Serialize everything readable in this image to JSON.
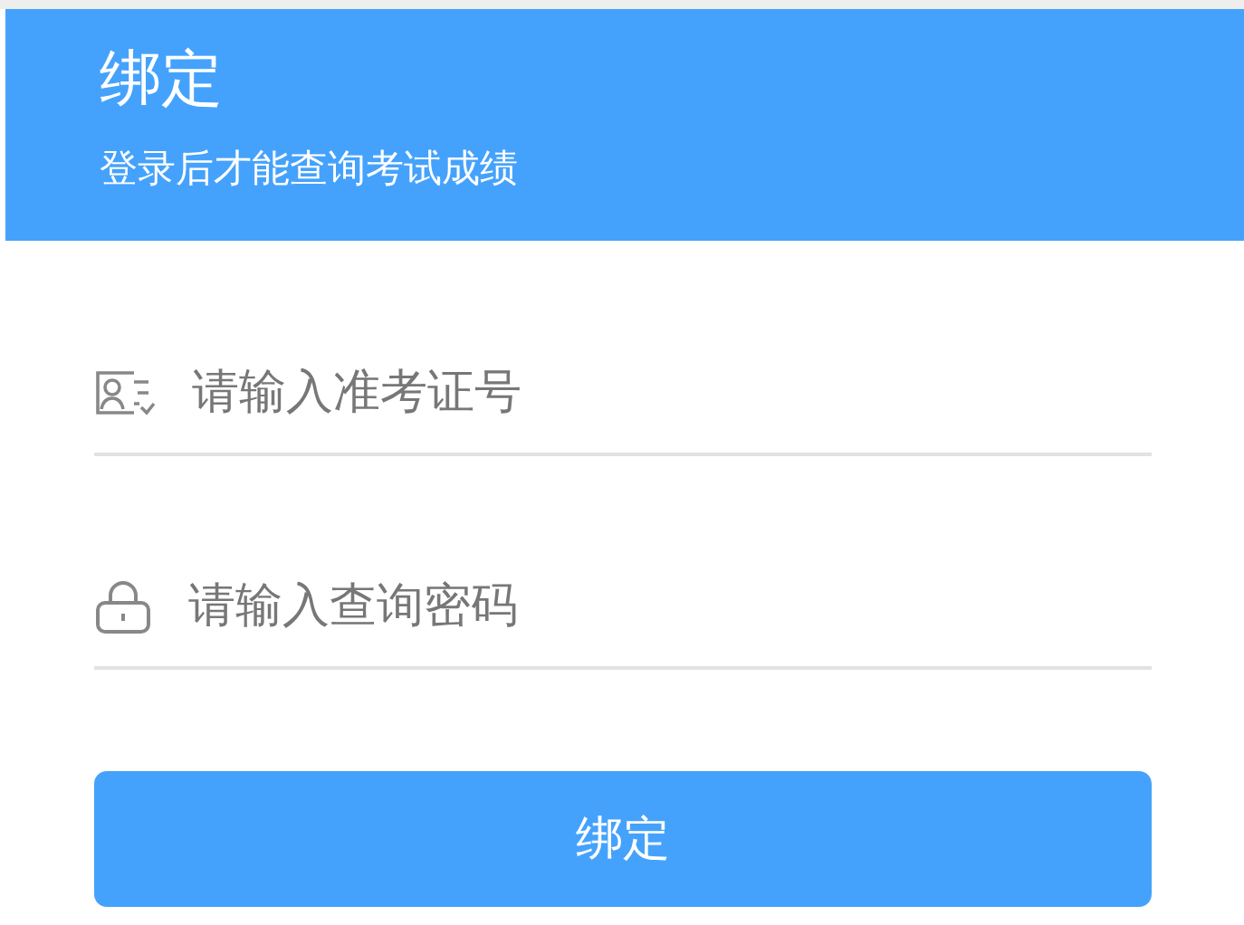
{
  "header": {
    "title": "绑定",
    "subtitle": "登录后才能查询考试成绩"
  },
  "fields": [
    {
      "kind": "id-card",
      "placeholder": "请输入准考证号"
    },
    {
      "kind": "password",
      "placeholder": "请输入查询密码"
    }
  ],
  "submit_button": "绑定"
}
